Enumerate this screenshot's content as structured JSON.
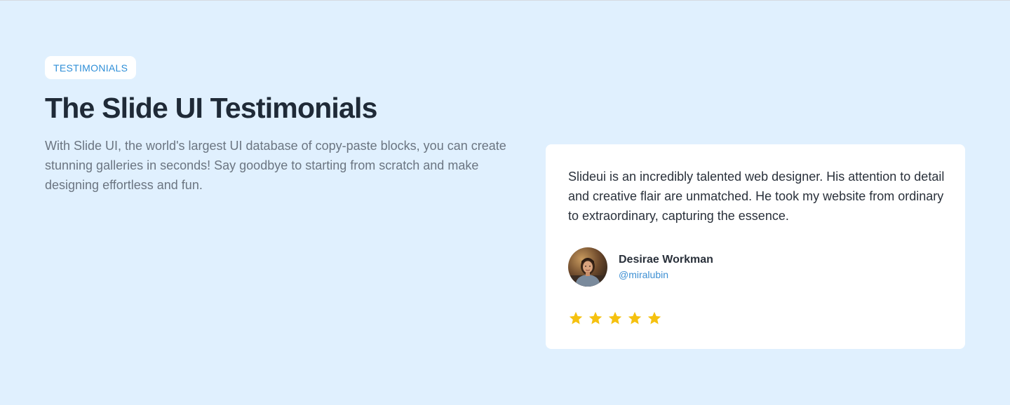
{
  "section": {
    "badge": "TESTIMONIALS",
    "title": "The Slide UI Testimonials",
    "description": "With Slide UI, the world's largest UI database of copy-paste blocks, you can create stunning galleries in seconds! Say goodbye to starting from scratch and make designing effortless and fun."
  },
  "testimonial": {
    "quote": "Slideui is an incredibly talented web designer. His attention to detail and creative flair are unmatched. He took my website from ordinary to extraordinary, capturing the essence.",
    "author_name": "Desirae Workman",
    "author_handle": "@miralubin",
    "rating": 5,
    "rating_max": 5,
    "star_icon": "star-icon",
    "avatar_icon": "avatar"
  },
  "colors": {
    "background": "#e0f0fe",
    "accent": "#2f8fd8",
    "star": "#f5c10f",
    "heading": "#1f2a37",
    "muted_text": "#6b7581"
  }
}
